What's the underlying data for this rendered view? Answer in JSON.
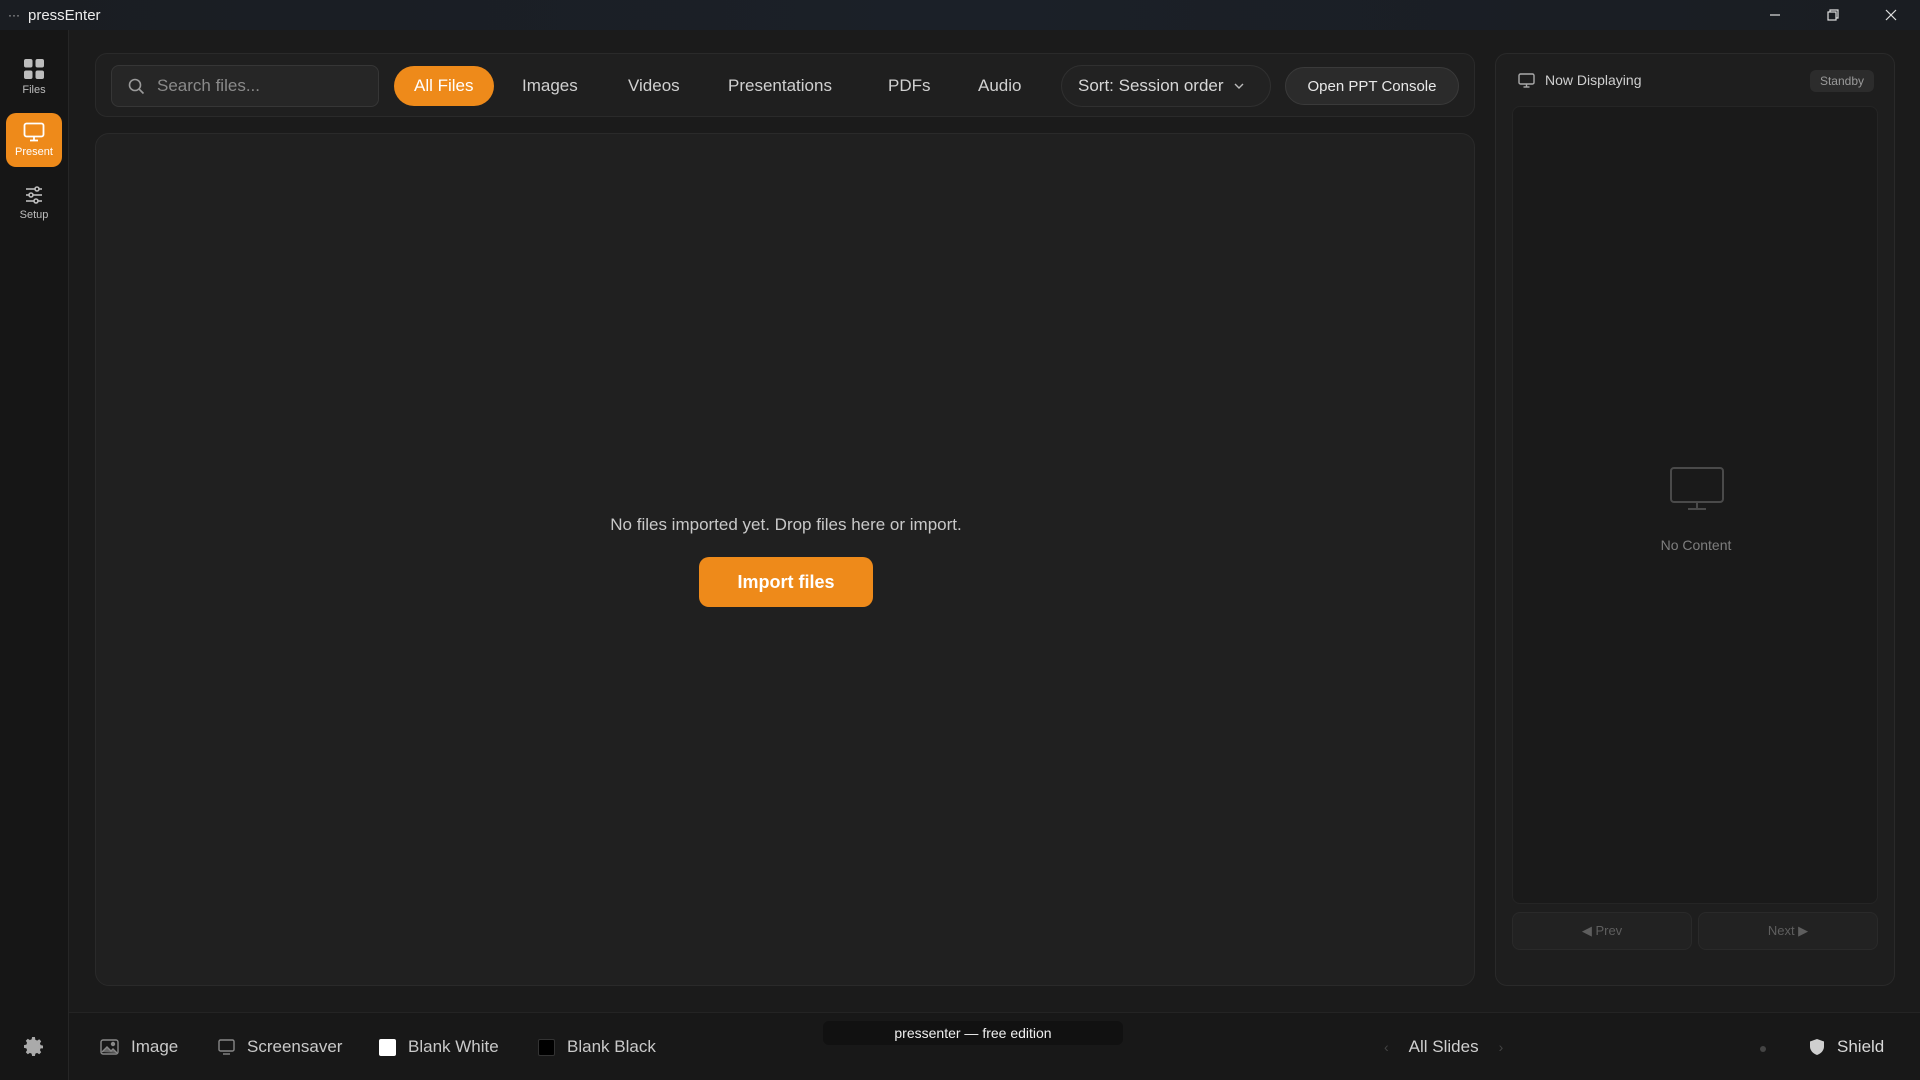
{
  "window": {
    "title": "pressEnter",
    "menu_glyph": "···"
  },
  "rail": {
    "items": [
      {
        "label": "Files",
        "icon": "grid-icon"
      },
      {
        "label": "Present",
        "icon": "monitor-icon",
        "active": true
      },
      {
        "label": "Setup",
        "icon": "sliders-icon"
      }
    ],
    "settings_icon": "gear-icon"
  },
  "toolbar": {
    "search_placeholder": "Search files...",
    "tabs": [
      {
        "label": "All Files",
        "active": true
      },
      {
        "label": "Images"
      },
      {
        "label": "Videos"
      },
      {
        "label": "Presentations"
      },
      {
        "label": "PDFs"
      },
      {
        "label": "Audio"
      }
    ],
    "sort_label": "Sort: Session order",
    "ppt_console_label": "Open PPT Console"
  },
  "main": {
    "empty_message": "No files imported yet. Drop files here or import.",
    "import_label": "Import files"
  },
  "display_panel": {
    "title": "Now Displaying",
    "status": "Standby",
    "empty_label": "No Content",
    "prev_label": "◀ Prev",
    "next_label": "Next ▶"
  },
  "bottombar": {
    "items": [
      {
        "label": "Image",
        "icon": "image-icon"
      },
      {
        "label": "Screensaver",
        "icon": "screen-icon"
      },
      {
        "label": "Blank White",
        "icon": "white-swatch"
      },
      {
        "label": "Blank Black",
        "icon": "black-swatch"
      }
    ],
    "edition": "pressenter — free edition",
    "slides_label": "All Slides",
    "prev_arrow": "‹",
    "next_arrow": "›",
    "shield_label": "Shield"
  },
  "colors": {
    "accent": "#ee8a1a",
    "background": "#1b1b1b"
  }
}
